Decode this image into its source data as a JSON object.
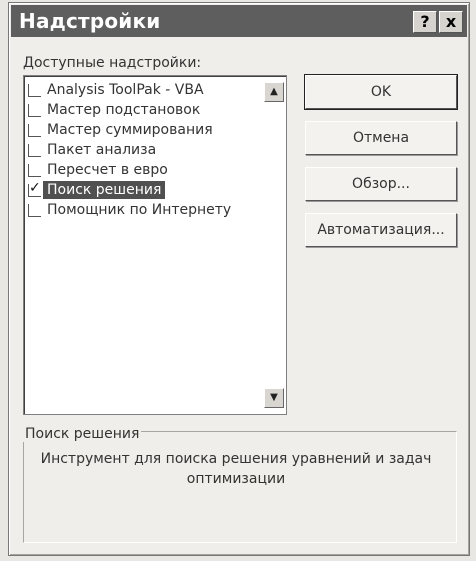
{
  "dialog": {
    "title": "Надстройки",
    "help_glyph": "?",
    "close_glyph": "x"
  },
  "addins_label": "Доступные надстройки:",
  "addins": [
    {
      "label": "Analysis ToolPak - VBA",
      "checked": false,
      "selected": false
    },
    {
      "label": "Мастер подстановок",
      "checked": false,
      "selected": false
    },
    {
      "label": "Мастер суммирования",
      "checked": false,
      "selected": false
    },
    {
      "label": "Пакет анализа",
      "checked": false,
      "selected": false
    },
    {
      "label": "Пересчет в евро",
      "checked": false,
      "selected": false
    },
    {
      "label": "Поиск решения",
      "checked": true,
      "selected": true
    },
    {
      "label": "Помощник по Интернету",
      "checked": false,
      "selected": false
    }
  ],
  "buttons": {
    "ok": "OK",
    "cancel": "Отмена",
    "browse": "Обзор...",
    "automation": "Автоматизация..."
  },
  "description": {
    "title": "Поиск решения",
    "text": "Инструмент для поиска решения уравнений и задач оптимизации"
  }
}
